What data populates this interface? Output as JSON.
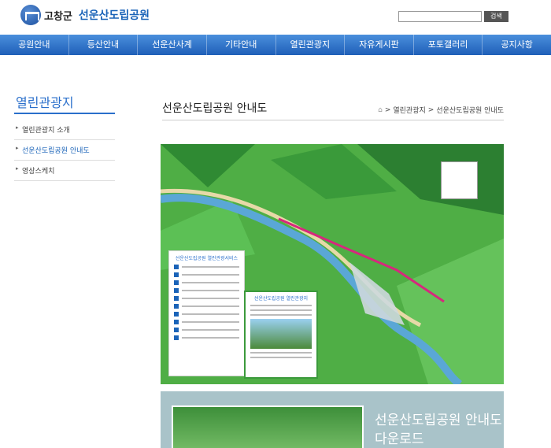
{
  "header": {
    "county": "고창군",
    "park": "선운산도립공원"
  },
  "search": {
    "button": "검색",
    "value": ""
  },
  "nav": [
    "공원안내",
    "등산안내",
    "선운산사계",
    "기타안내",
    "열린관광지",
    "자유게시판",
    "포토갤러리",
    "공지사항"
  ],
  "sidebar": {
    "title": "열린관광지",
    "items": [
      "열린관광지 소개",
      "선운산도립공원 안내도",
      "영상스케치"
    ]
  },
  "main": {
    "title": "선운산도립공원 안내도",
    "breadcrumb": [
      "열린관광지",
      "선운산도립공원 안내도"
    ]
  },
  "map": {
    "legend_title": "선운산도립공원 열린관광서비스",
    "card_title": "선운산도립공원 열린관광지"
  },
  "download": {
    "line1": "선운산도립공원 안내도",
    "line2": "다운로드"
  },
  "colors": {
    "nav": "#2f6fc4",
    "accent": "#2a6fcb",
    "map_green": "#4fae45"
  }
}
